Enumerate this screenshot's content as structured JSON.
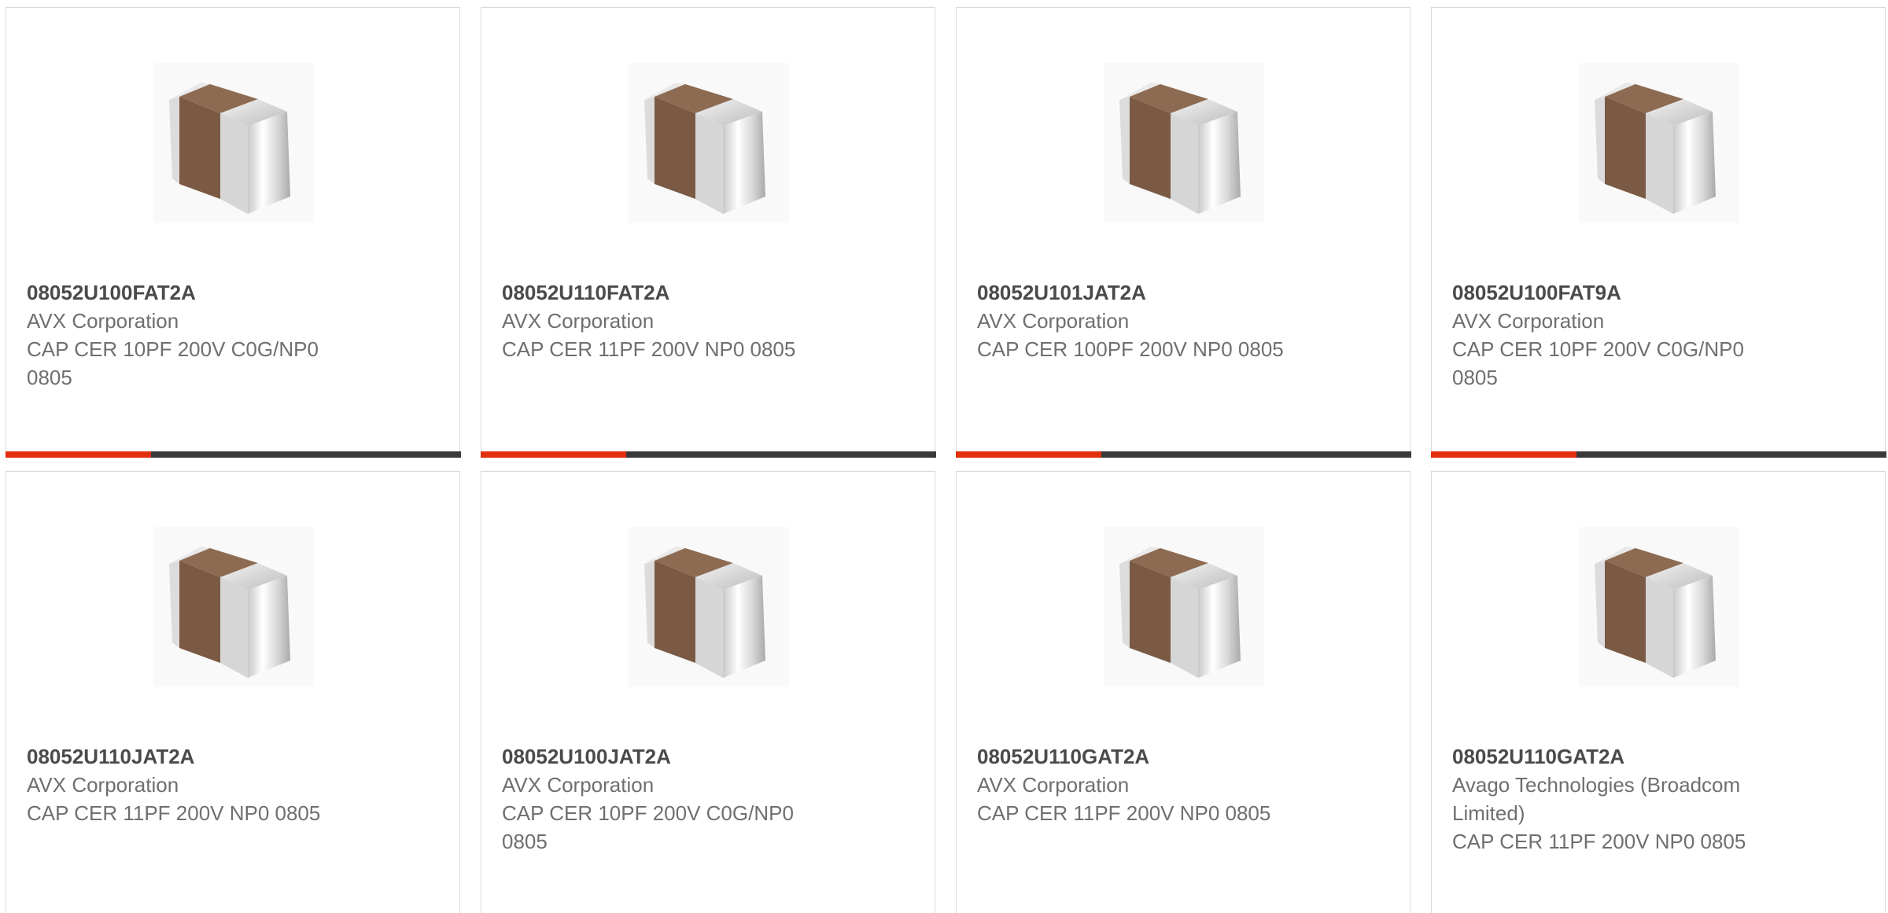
{
  "products": [
    {
      "part_number": "08052U100FAT2A",
      "manufacturer": "AVX Corporation",
      "description": "CAP CER 10PF 200V C0G/NP0 0805",
      "image_icon": "ceramic-capacitor-chip",
      "progress": 0.32
    },
    {
      "part_number": "08052U110FAT2A",
      "manufacturer": "AVX Corporation",
      "description": "CAP CER 11PF 200V NP0 0805",
      "image_icon": "ceramic-capacitor-chip",
      "progress": 0.32
    },
    {
      "part_number": "08052U101JAT2A",
      "manufacturer": "AVX Corporation",
      "description": "CAP CER 100PF 200V NP0 0805",
      "image_icon": "ceramic-capacitor-chip",
      "progress": 0.32
    },
    {
      "part_number": "08052U100FAT9A",
      "manufacturer": "AVX Corporation",
      "description": "CAP CER 10PF 200V C0G/NP0 0805",
      "image_icon": "ceramic-capacitor-chip",
      "progress": 0.32
    },
    {
      "part_number": "08052U110JAT2A",
      "manufacturer": "AVX Corporation",
      "description": "CAP CER 11PF 200V NP0 0805",
      "image_icon": "ceramic-capacitor-chip"
    },
    {
      "part_number": "08052U100JAT2A",
      "manufacturer": "AVX Corporation",
      "description": "CAP CER 10PF 200V C0G/NP0 0805",
      "image_icon": "ceramic-capacitor-chip"
    },
    {
      "part_number": "08052U110GAT2A",
      "manufacturer": "AVX Corporation",
      "description": "CAP CER 11PF 200V NP0 0805",
      "image_icon": "ceramic-capacitor-chip"
    },
    {
      "part_number": "08052U110GAT2A",
      "manufacturer": "Avago Technologies (Broadcom Limited)",
      "description": "CAP CER 11PF 200V NP0 0805",
      "image_icon": "ceramic-capacitor-chip"
    }
  ],
  "colors": {
    "accent": "#e2300e",
    "bar_track": "#3a3a3a",
    "part_number_text": "#4a4a4a",
    "body_text": "#6f6f6f",
    "card_border": "#d9d9d9"
  }
}
